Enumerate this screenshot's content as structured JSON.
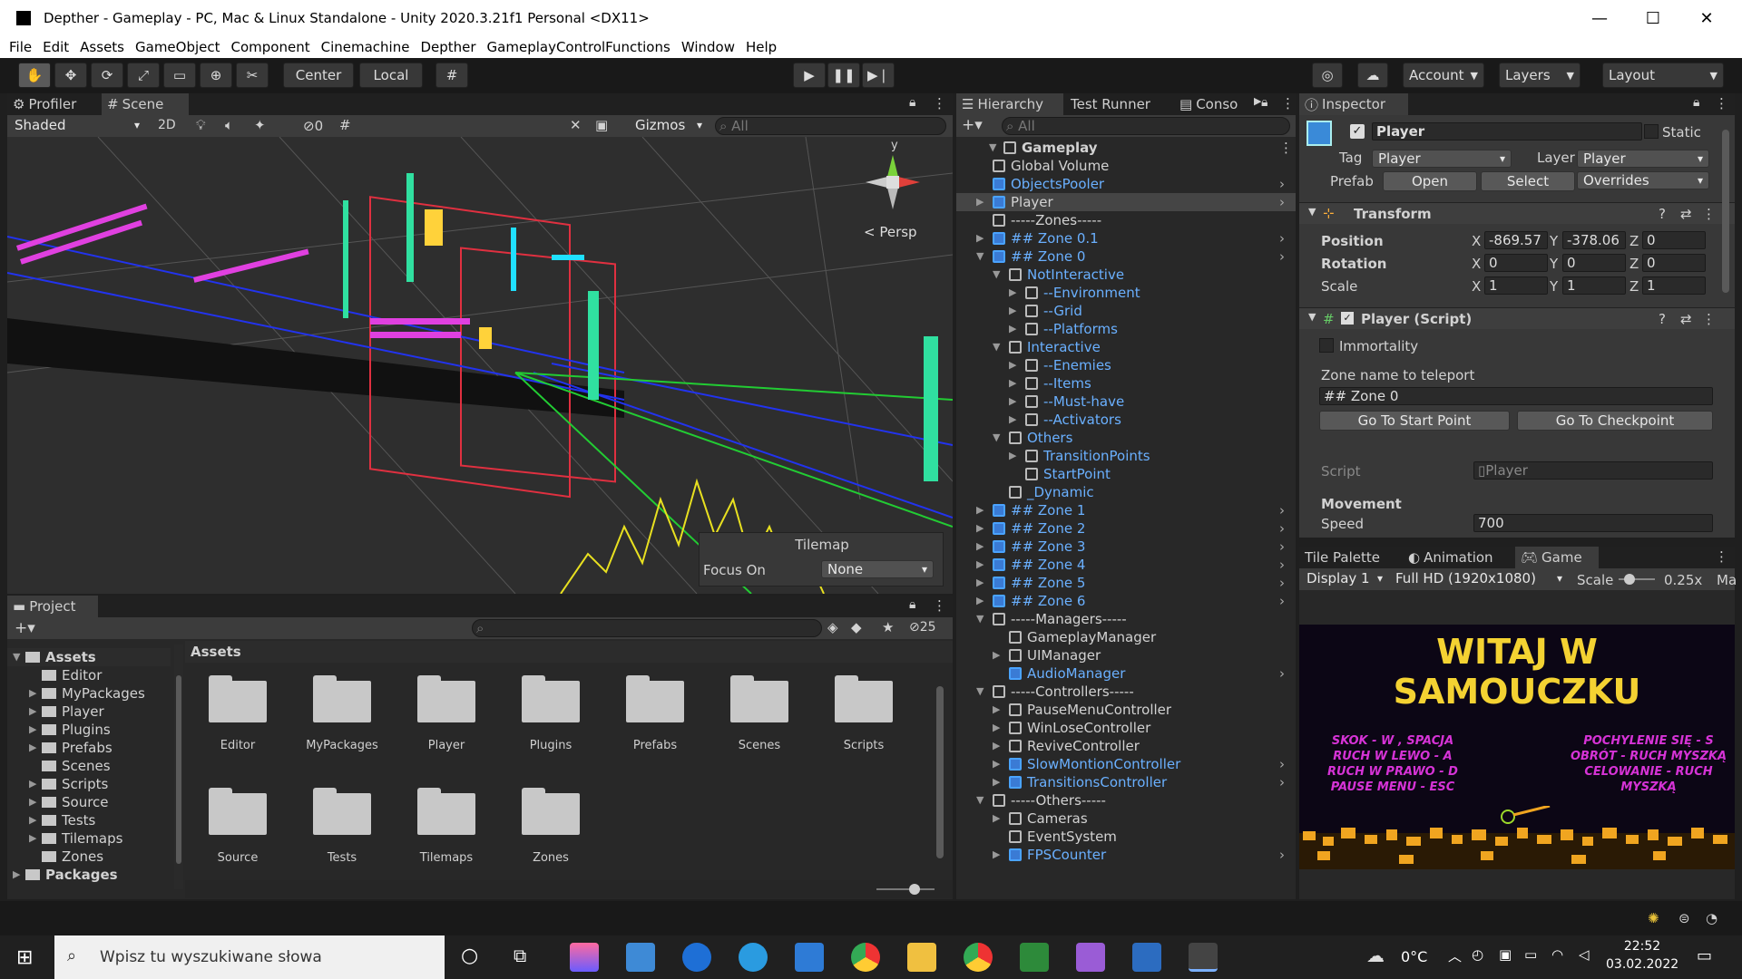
{
  "window": {
    "title": "Depther - Gameplay - PC, Mac & Linux Standalone - Unity 2020.3.21f1 Personal <DX11>",
    "controls": [
      "—",
      "☐",
      "✕"
    ]
  },
  "menu": [
    "File",
    "Edit",
    "Assets",
    "GameObject",
    "Component",
    "Cinemachine",
    "Depther",
    "GameplayControlFunctions",
    "Window",
    "Help"
  ],
  "toolbar": {
    "center": "Center",
    "local": "Local",
    "account": "Account",
    "layers": "Layers",
    "layout": "Layout"
  },
  "scene": {
    "tabs": [
      "Profiler",
      "Scene"
    ],
    "shading": "Shaded",
    "mode2d": "2D",
    "hidden_count": "0",
    "gizmos": "Gizmos",
    "search_placeholder": "All",
    "persp": "< Persp",
    "axis_y": "y",
    "tilemap": {
      "title": "Tilemap",
      "focus_label": "Focus On",
      "focus_value": "None"
    }
  },
  "project": {
    "tab": "Project",
    "count": "25",
    "breadcrumb": "Assets",
    "tree": [
      {
        "label": "Assets",
        "level": 0,
        "bold": true
      },
      {
        "label": "Editor",
        "level": 1
      },
      {
        "label": "MyPackages",
        "level": 1
      },
      {
        "label": "Player",
        "level": 1
      },
      {
        "label": "Plugins",
        "level": 1
      },
      {
        "label": "Prefabs",
        "level": 1
      },
      {
        "label": "Scenes",
        "level": 1
      },
      {
        "label": "Scripts",
        "level": 1
      },
      {
        "label": "Source",
        "level": 1
      },
      {
        "label": "Tests",
        "level": 1
      },
      {
        "label": "Tilemaps",
        "level": 1
      },
      {
        "label": "Zones",
        "level": 1
      },
      {
        "label": "Packages",
        "level": 0,
        "bold": true
      }
    ],
    "folders": [
      "Editor",
      "MyPackages",
      "Player",
      "Plugins",
      "Prefabs",
      "Scenes",
      "Scripts",
      "Source",
      "Tests",
      "Tilemaps",
      "Zones"
    ]
  },
  "hierarchy": {
    "tabs": [
      "Hierarchy",
      "Test Runner",
      "Conso"
    ],
    "search_placeholder": "All",
    "rows": [
      {
        "label": "Gameplay",
        "indent": 0,
        "icon": "scene",
        "bold": true,
        "arrow": "▼"
      },
      {
        "label": "Global Volume",
        "indent": 1,
        "icon": "cube"
      },
      {
        "label": "ObjectsPooler",
        "indent": 1,
        "icon": "blue",
        "link": true,
        "chev": true
      },
      {
        "label": "Player",
        "indent": 1,
        "icon": "blue",
        "arrow": "▶",
        "chev": true,
        "sel": true
      },
      {
        "label": "-----Zones-----",
        "indent": 1,
        "icon": "cube"
      },
      {
        "label": "## Zone 0.1",
        "indent": 1,
        "icon": "blue",
        "arrow": "▶",
        "link": true,
        "chev": true
      },
      {
        "label": "## Zone 0",
        "indent": 1,
        "icon": "blue",
        "arrow": "▼",
        "link": true,
        "chev": true
      },
      {
        "label": "NotInteractive",
        "indent": 2,
        "icon": "cube",
        "arrow": "▼",
        "link": true
      },
      {
        "label": "--Environment",
        "indent": 3,
        "icon": "cube",
        "arrow": "▶",
        "link": true
      },
      {
        "label": "--Grid",
        "indent": 3,
        "icon": "cube",
        "arrow": "▶",
        "link": true
      },
      {
        "label": "--Platforms",
        "indent": 3,
        "icon": "cube",
        "arrow": "▶",
        "link": true
      },
      {
        "label": "Interactive",
        "indent": 2,
        "icon": "cube",
        "arrow": "▼",
        "link": true
      },
      {
        "label": "--Enemies",
        "indent": 3,
        "icon": "cube",
        "arrow": "▶",
        "link": true
      },
      {
        "label": "--Items",
        "indent": 3,
        "icon": "cube",
        "arrow": "▶",
        "link": true
      },
      {
        "label": "--Must-have",
        "indent": 3,
        "icon": "cube",
        "arrow": "▶",
        "link": true
      },
      {
        "label": "--Activators",
        "indent": 3,
        "icon": "cube",
        "arrow": "▶",
        "link": true
      },
      {
        "label": "Others",
        "indent": 2,
        "icon": "cube",
        "arrow": "▼",
        "link": true
      },
      {
        "label": "TransitionPoints",
        "indent": 3,
        "icon": "cube",
        "arrow": "▶",
        "link": true
      },
      {
        "label": "StartPoint",
        "indent": 3,
        "icon": "cube",
        "link": true
      },
      {
        "label": "_Dynamic",
        "indent": 2,
        "icon": "cube",
        "link": true
      },
      {
        "label": "## Zone 1",
        "indent": 1,
        "icon": "blue",
        "arrow": "▶",
        "link": true,
        "chev": true
      },
      {
        "label": "## Zone 2",
        "indent": 1,
        "icon": "blue",
        "arrow": "▶",
        "link": true,
        "chev": true
      },
      {
        "label": "## Zone 3",
        "indent": 1,
        "icon": "blue",
        "arrow": "▶",
        "link": true,
        "chev": true
      },
      {
        "label": "## Zone 4",
        "indent": 1,
        "icon": "blue",
        "arrow": "▶",
        "link": true,
        "chev": true
      },
      {
        "label": "## Zone 5",
        "indent": 1,
        "icon": "blue",
        "arrow": "▶",
        "link": true,
        "chev": true
      },
      {
        "label": "## Zone 6",
        "indent": 1,
        "icon": "blue",
        "arrow": "▶",
        "link": true,
        "chev": true
      },
      {
        "label": "-----Managers-----",
        "indent": 1,
        "icon": "cube",
        "arrow": "▼"
      },
      {
        "label": "GameplayManager",
        "indent": 2,
        "icon": "cube"
      },
      {
        "label": "UIManager",
        "indent": 2,
        "icon": "cube",
        "arrow": "▶"
      },
      {
        "label": "AudioManager",
        "indent": 2,
        "icon": "blue",
        "link": true,
        "chev": true
      },
      {
        "label": "-----Controllers-----",
        "indent": 1,
        "icon": "cube",
        "arrow": "▼"
      },
      {
        "label": "PauseMenuController",
        "indent": 2,
        "icon": "cube",
        "arrow": "▶"
      },
      {
        "label": "WinLoseController",
        "indent": 2,
        "icon": "cube",
        "arrow": "▶"
      },
      {
        "label": "ReviveController",
        "indent": 2,
        "icon": "cube",
        "arrow": "▶"
      },
      {
        "label": "SlowMontionController",
        "indent": 2,
        "icon": "blue",
        "arrow": "▶",
        "link": true,
        "chev": true
      },
      {
        "label": "TransitionsController",
        "indent": 2,
        "icon": "blue",
        "arrow": "▶",
        "link": true,
        "chev": true
      },
      {
        "label": "-----Others-----",
        "indent": 1,
        "icon": "cube",
        "arrow": "▼"
      },
      {
        "label": "Cameras",
        "indent": 2,
        "icon": "cube",
        "arrow": "▶"
      },
      {
        "label": "EventSystem",
        "indent": 2,
        "icon": "cube"
      },
      {
        "label": "FPSCounter",
        "indent": 2,
        "icon": "blue",
        "arrow": "▶",
        "link": true,
        "chev": true
      }
    ]
  },
  "inspector": {
    "tab": "Inspector",
    "name": "Player",
    "static": "Static",
    "tag_label": "Tag",
    "tag": "Player",
    "layer_label": "Layer",
    "layer": "Player",
    "prefab_label": "Prefab",
    "open": "Open",
    "select": "Select",
    "overrides": "Overrides",
    "transform": {
      "title": "Transform",
      "position_label": "Position",
      "rotation_label": "Rotation",
      "scale_label": "Scale",
      "position": [
        "-869.57",
        "-378.06",
        "0"
      ],
      "rotation": [
        "0",
        "0",
        "0"
      ],
      "scale": [
        "1",
        "1",
        "1"
      ],
      "axes": [
        "X",
        "Y",
        "Z"
      ]
    },
    "script": {
      "title": "Player (Script)",
      "immortality": "Immortality",
      "zone_label": "Zone name to teleport",
      "zone_value": "## Zone 0",
      "btn_start": "Go To Start Point",
      "btn_checkpoint": "Go To Checkpoint",
      "script_label": "Script",
      "script_value": "Player",
      "movement": "Movement",
      "speed_label": "Speed",
      "speed_value": "700"
    }
  },
  "game": {
    "tabs": [
      "Tile Palette",
      "Animation",
      "Game"
    ],
    "display": "Display 1",
    "resolution": "Full HD (1920x1080)",
    "scale_label": "Scale",
    "scale_value": "0.25x",
    "ma": "Ma",
    "title_line1": "WITAJ W",
    "title_line2": "SAMOUCZKU",
    "left_text": [
      "SKOK - W , SPACJA",
      "RUCH W LEWO - A",
      "RUCH W PRAWO - D",
      "PAUSE MENU - ESC"
    ],
    "right_text": [
      "POCHYLENIE SIĘ - S",
      "OBRÓT - RUCH MYSZKĄ",
      "CELOWANIE - RUCH",
      "MYSZKĄ"
    ]
  },
  "taskbar": {
    "search_placeholder": "Wpisz tu wyszukiwane słowa",
    "temp": "0°C",
    "time": "22:52",
    "date": "03.02.2022"
  },
  "colors": {
    "link": "#6ab0ff",
    "select": "#2c5d87",
    "accent": "#4aa3ff"
  }
}
